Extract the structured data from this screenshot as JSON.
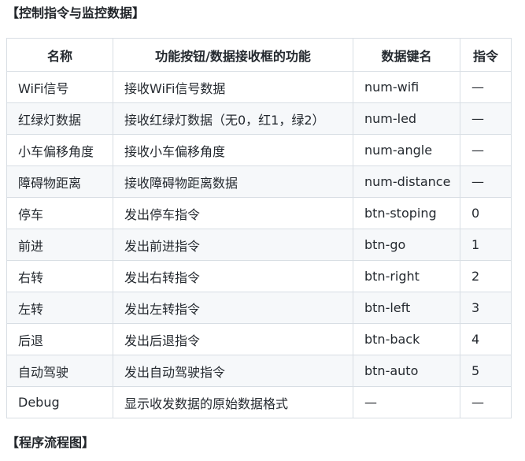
{
  "sections": {
    "control_title": "【控制指令与监控数据】",
    "flow_title": "【程序流程图】"
  },
  "table": {
    "headers": [
      "名称",
      "功能按钮/数据接收框的功能",
      "数据键名",
      "指令"
    ],
    "rows": [
      {
        "name": "WiFi信号",
        "function": "接收WiFi信号数据",
        "key": "num-wifi",
        "command": "—"
      },
      {
        "name": "红绿灯数据",
        "function": "接收红绿灯数据（无0，红1，绿2）",
        "key": "num-led",
        "command": "—"
      },
      {
        "name": "小车偏移角度",
        "function": "接收小车偏移角度",
        "key": "num-angle",
        "command": "—"
      },
      {
        "name": "障碍物距离",
        "function": "接收障碍物距离数据",
        "key": "num-distance",
        "command": "—"
      },
      {
        "name": "停车",
        "function": "发出停车指令",
        "key": "btn-stoping",
        "command": "0"
      },
      {
        "name": "前进",
        "function": "发出前进指令",
        "key": "btn-go",
        "command": "1"
      },
      {
        "name": "右转",
        "function": "发出右转指令",
        "key": "btn-right",
        "command": "2"
      },
      {
        "name": "左转",
        "function": "发出左转指令",
        "key": "btn-left",
        "command": "3"
      },
      {
        "name": "后退",
        "function": "发出后退指令",
        "key": "btn-back",
        "command": "4"
      },
      {
        "name": "自动驾驶",
        "function": "发出自动驾驶指令",
        "key": "btn-auto",
        "command": "5"
      },
      {
        "name": "Debug",
        "function": "显示收发数据的原始数据格式",
        "key": "—",
        "command": "—"
      }
    ]
  }
}
